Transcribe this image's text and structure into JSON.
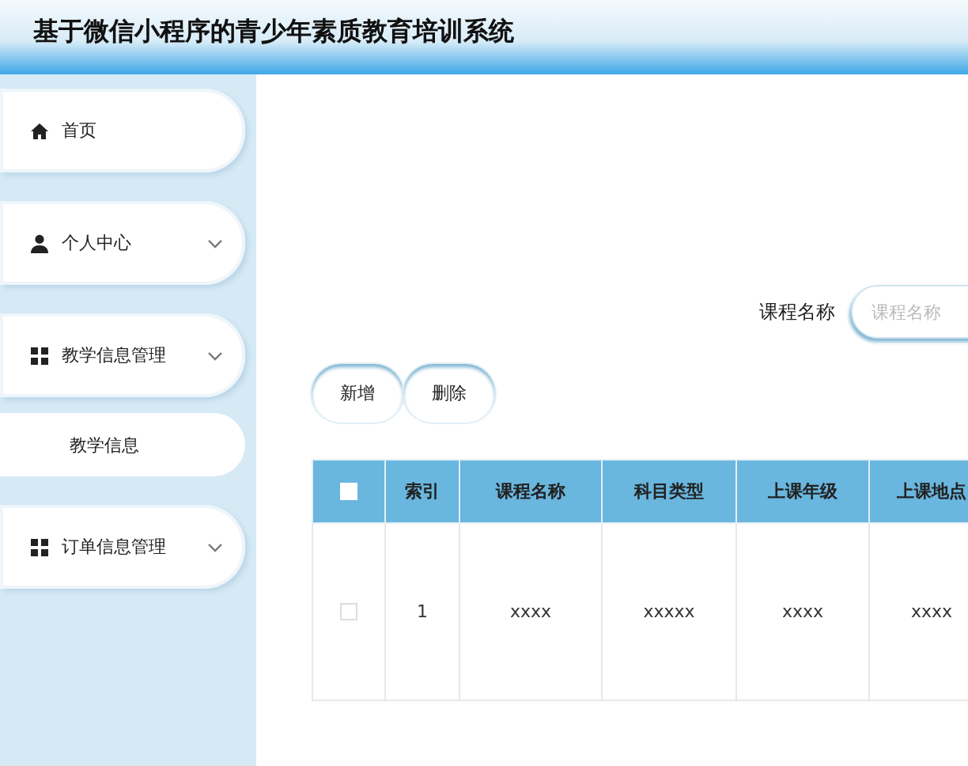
{
  "header": {
    "title": "基于微信小程序的青少年素质教育培训系统"
  },
  "sidebar": {
    "items": [
      {
        "label": "首页",
        "kind": "link"
      },
      {
        "label": "个人中心",
        "kind": "menu"
      },
      {
        "label": "教学信息管理",
        "kind": "menu",
        "children": [
          {
            "label": "教学信息"
          }
        ]
      },
      {
        "label": "订单信息管理",
        "kind": "menu"
      }
    ]
  },
  "search": {
    "label": "课程名称",
    "placeholder": "课程名称"
  },
  "buttons": [
    "新增",
    "删除"
  ],
  "table": {
    "all_checked": false,
    "columns": [
      "索引",
      "课程名称",
      "科目类型",
      "上课年级",
      "上课地点"
    ],
    "rows": [
      {
        "checked": false,
        "cells": [
          "1",
          "xxxx",
          "xxxxx",
          "xxxx",
          "xxxx"
        ]
      }
    ]
  }
}
